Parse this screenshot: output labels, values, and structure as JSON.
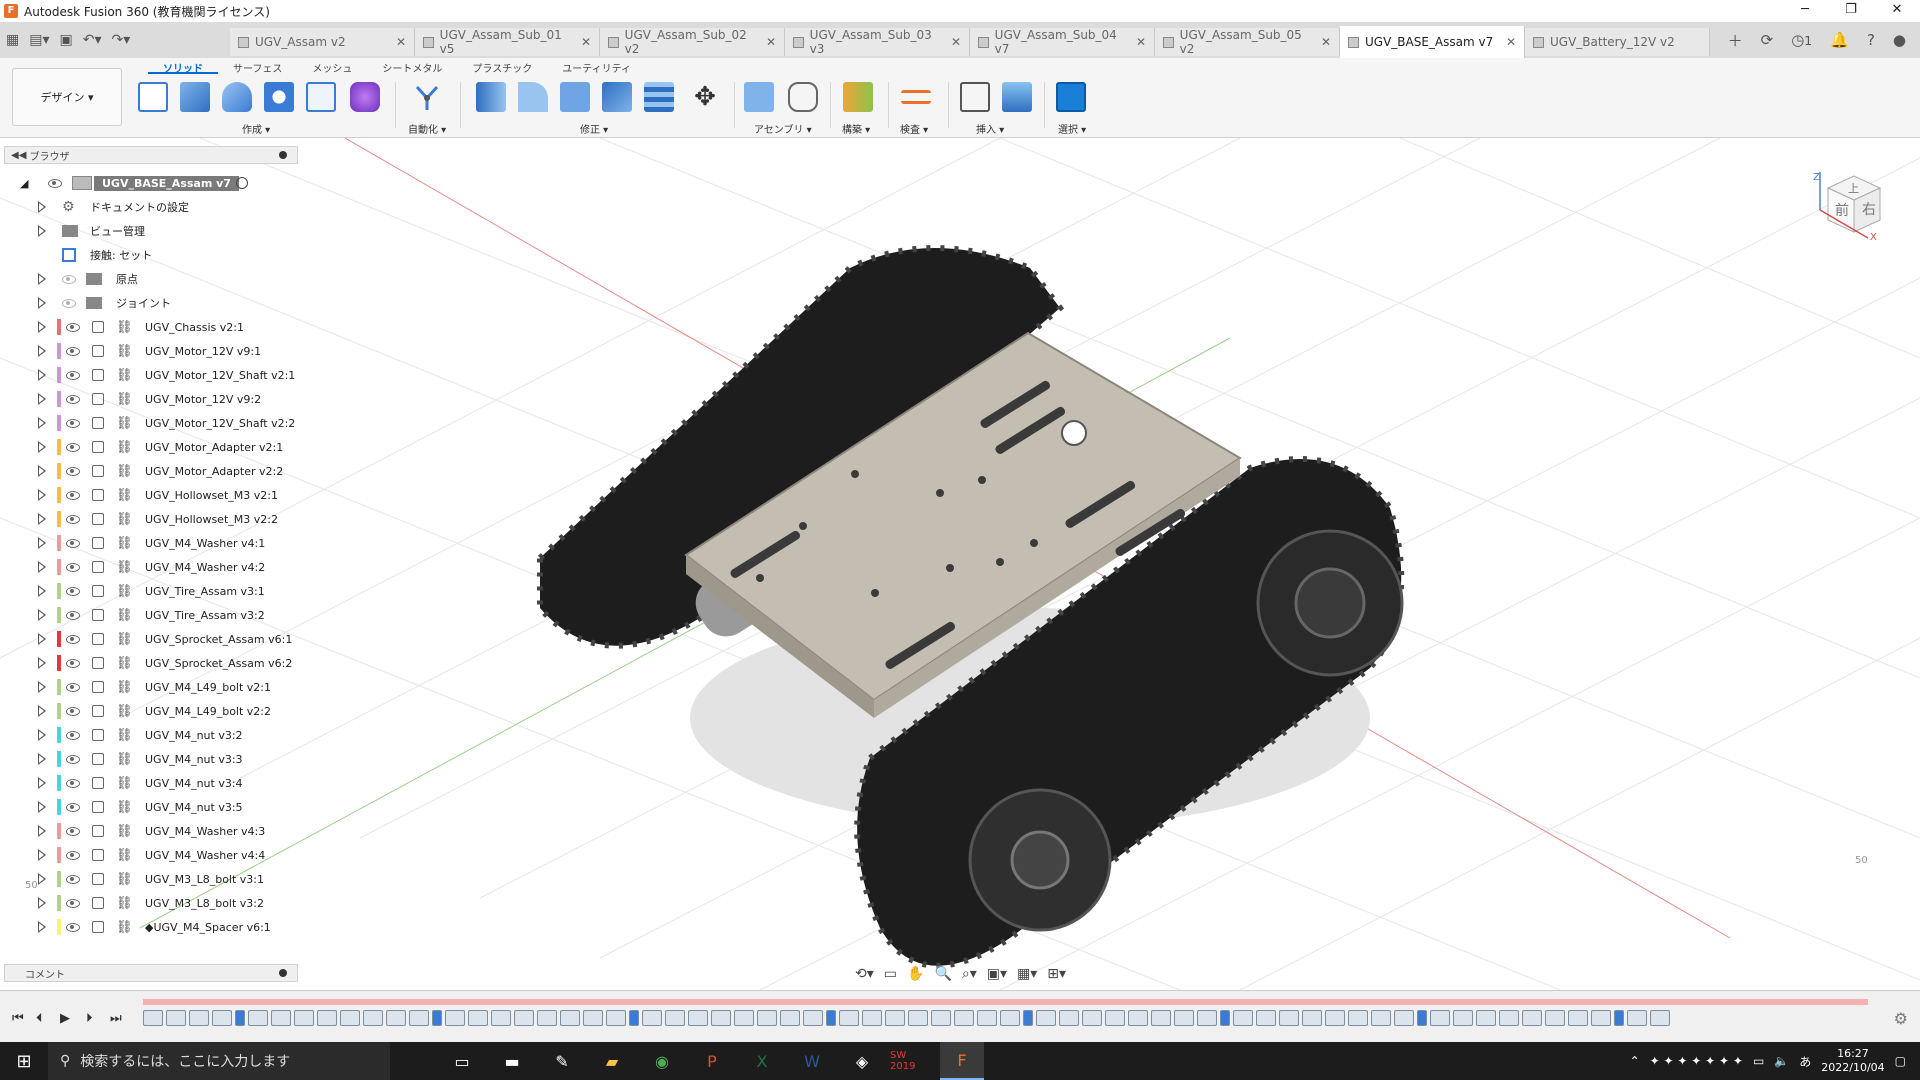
{
  "window": {
    "title": "Autodesk Fusion 360 (教育機関ライセンス)",
    "minimize": "─",
    "maximize": "❐",
    "close": "✕"
  },
  "doc_tabs": [
    {
      "label": "UGV_Assam v2",
      "active": false
    },
    {
      "label": "UGV_Assam_Sub_01 v5",
      "active": false
    },
    {
      "label": "UGV_Assam_Sub_02 v2",
      "active": false
    },
    {
      "label": "UGV_Assam_Sub_03 v3",
      "active": false
    },
    {
      "label": "UGV_Assam_Sub_04 v7",
      "active": false
    },
    {
      "label": "UGV_Assam_Sub_05 v2",
      "active": false
    },
    {
      "label": "UGV_BASE_Assam v7",
      "active": true
    },
    {
      "label": "UGV_Battery_12V v2",
      "active": false
    }
  ],
  "tabbar_right": {
    "job_count": "1"
  },
  "workspace": {
    "label": "デザイン ▾"
  },
  "ribbon_tabs": [
    "ソリッド",
    "サーフェス",
    "メッシュ",
    "シートメタル",
    "プラスチック",
    "ユーティリティ"
  ],
  "ribbon_groups": [
    "作成 ▾",
    "自動化 ▾",
    "修正 ▾",
    "アセンブリ ▾",
    "構築 ▾",
    "検査 ▾",
    "挿入 ▾",
    "選択 ▾"
  ],
  "browser": {
    "title": "ブラウザ",
    "root": "UGV_BASE_Assam v7",
    "folders": [
      "ドキュメントの設定",
      "ビュー管理",
      "接触: セット",
      "原点",
      "ジョイント"
    ],
    "components": [
      {
        "name": "UGV_Chassis v2:1",
        "color": "#e57373"
      },
      {
        "name": "UGV_Motor_12V v9:1",
        "color": "#ce93d8"
      },
      {
        "name": "UGV_Motor_12V_Shaft v2:1",
        "color": "#ce93d8"
      },
      {
        "name": "UGV_Motor_12V v9:2",
        "color": "#ce93d8"
      },
      {
        "name": "UGV_Motor_12V_Shaft v2:2",
        "color": "#ce93d8"
      },
      {
        "name": "UGV_Motor_Adapter v2:1",
        "color": "#ffb74d"
      },
      {
        "name": "UGV_Motor_Adapter v2:2",
        "color": "#ffb74d"
      },
      {
        "name": "UGV_Hollowset_M3 v2:1",
        "color": "#ffb74d"
      },
      {
        "name": "UGV_Hollowset_M3 v2:2",
        "color": "#ffb74d"
      },
      {
        "name": "UGV_M4_Washer v4:1",
        "color": "#ef9a9a"
      },
      {
        "name": "UGV_M4_Washer v4:2",
        "color": "#ef9a9a"
      },
      {
        "name": "UGV_Tire_Assam v3:1",
        "color": "#aed581"
      },
      {
        "name": "UGV_Tire_Assam v3:2",
        "color": "#aed581"
      },
      {
        "name": "UGV_Sprocket_Assam v6:1",
        "color": "#e53935"
      },
      {
        "name": "UGV_Sprocket_Assam v6:2",
        "color": "#e53935"
      },
      {
        "name": "UGV_M4_L49_bolt v2:1",
        "color": "#aed581"
      },
      {
        "name": "UGV_M4_L49_bolt v2:2",
        "color": "#aed581"
      },
      {
        "name": "UGV_M4_nut v3:2",
        "color": "#4dd0e1"
      },
      {
        "name": "UGV_M4_nut v3:3",
        "color": "#4dd0e1"
      },
      {
        "name": "UGV_M4_nut v3:4",
        "color": "#4dd0e1"
      },
      {
        "name": "UGV_M4_nut v3:5",
        "color": "#4dd0e1"
      },
      {
        "name": "UGV_M4_Washer v4:3",
        "color": "#ef9a9a"
      },
      {
        "name": "UGV_M4_Washer v4:4",
        "color": "#ef9a9a"
      },
      {
        "name": "UGV_M3_L8_bolt v3:1",
        "color": "#aed581"
      },
      {
        "name": "UGV_M3_L8_bolt v3:2",
        "color": "#aed581"
      },
      {
        "name": "◆UGV_M4_Spacer v6:1",
        "color": "#fff176"
      }
    ]
  },
  "comments": {
    "title": "コメント"
  },
  "viewcube": {
    "front": "前",
    "right": "右",
    "top": "上",
    "z": "Z",
    "x": "X"
  },
  "viewport": {
    "scale_label_1": "50",
    "scale_label_2": "50"
  },
  "taskbar": {
    "search_placeholder": "検索するには、ここに入力します",
    "time": "16:27",
    "date": "2022/10/04",
    "sw_label": "SW 2019"
  }
}
